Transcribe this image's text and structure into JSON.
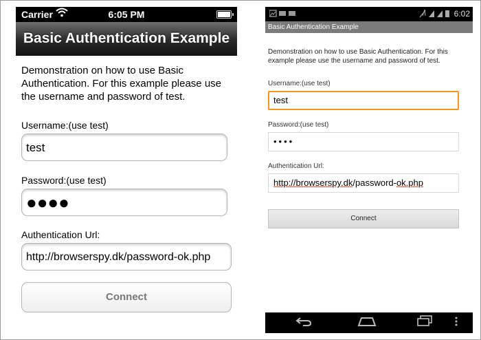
{
  "ios": {
    "status": {
      "carrier": "Carrier",
      "time": "6:05 PM"
    },
    "nav_title": "Basic Authentication Example",
    "description": "Demonstration on how to use Basic Authentication. For this example please use the username and password of test.",
    "username_label": "Username:(use test)",
    "username_value": "test",
    "password_label": "Password:(use test)",
    "password_value": "●●●●",
    "url_label": "Authentication Url:",
    "url_value": "http://browserspy.dk/password-ok.php",
    "connect_label": "Connect"
  },
  "android": {
    "status": {
      "time": "6:02"
    },
    "title": "Basic Authentication Example",
    "description": "Demonstration on how to use Basic Authentication. For this example please use the username and password of test.",
    "username_label": "Username:(use test)",
    "username_value": "test",
    "password_label": "Password:(use test)",
    "password_value": "••••",
    "url_label": "Authentication Url:",
    "url_parts": {
      "p1": "http://",
      "p2": "browserspy.dk",
      "p3": "/password-",
      "p4": "ok.php"
    },
    "connect_label": "Connect",
    "nav_icons": [
      "back-icon",
      "home-icon",
      "recent-apps-icon",
      "menu-icon"
    ]
  },
  "colors": {
    "android_focus": "#f7941d",
    "spell_underline": "#e04b2a",
    "ios_nav_dark": "#141414"
  }
}
